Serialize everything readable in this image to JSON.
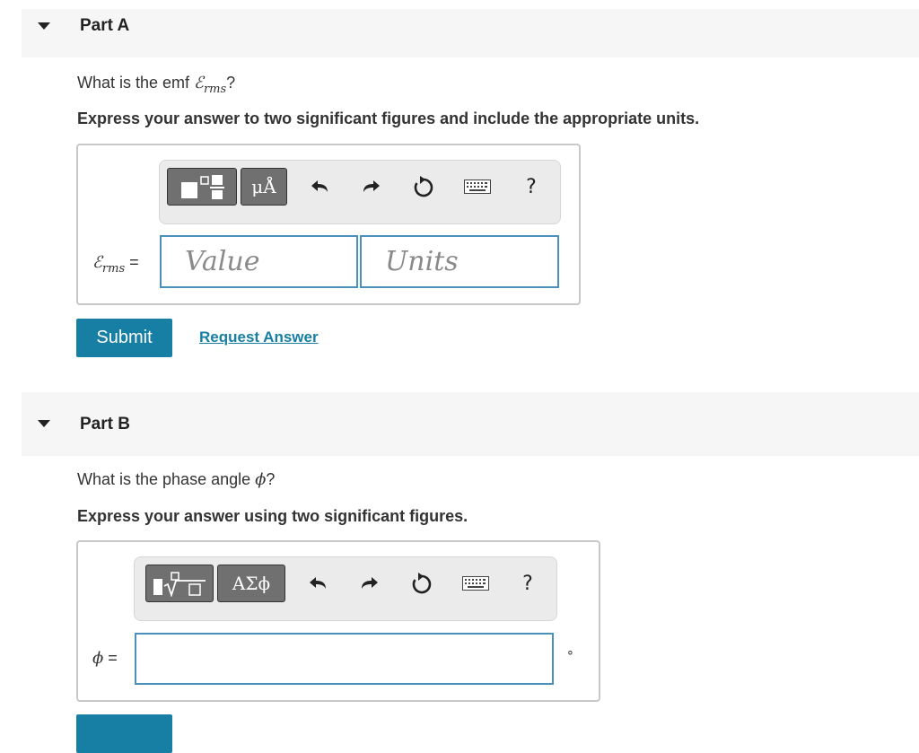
{
  "partA": {
    "title": "Part A",
    "question_prefix": "What is the emf ",
    "question_symbol": "ℰ",
    "question_sub": "rms",
    "question_suffix": "?",
    "instruction": "Express your answer to two significant figures and include the appropriate units.",
    "toolbar": {
      "units_button": "μÅ",
      "help": "?"
    },
    "label_symbol": "ℰ",
    "label_sub": "rms",
    "label_eq": " =",
    "value_placeholder": "Value",
    "units_placeholder": "Units",
    "submit_label": "Submit",
    "request_label": "Request Answer"
  },
  "partB": {
    "title": "Part B",
    "question_prefix": "What is the phase angle ",
    "question_symbol": "ϕ",
    "question_suffix": "?",
    "instruction": "Express your answer using two significant figures.",
    "toolbar": {
      "greek_button": "ΑΣϕ",
      "help": "?"
    },
    "label_symbol": "ϕ",
    "label_eq": " =",
    "unit_suffix": "∘"
  },
  "colors": {
    "accent": "#177fa3",
    "field_border": "#4a90b8",
    "header_bg": "#f6f6f6"
  }
}
